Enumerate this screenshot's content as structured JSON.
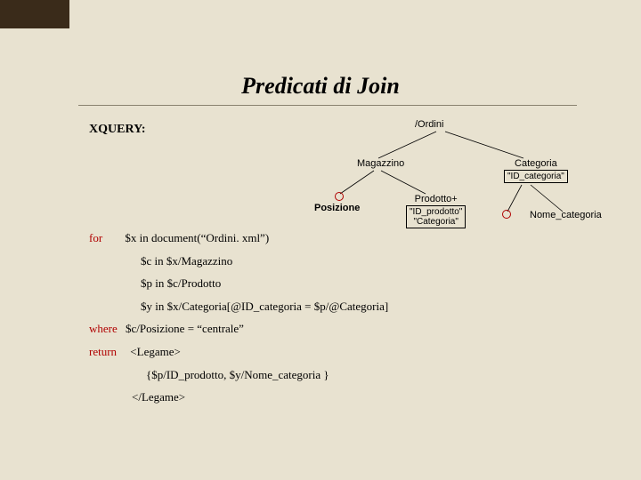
{
  "title": "Predicati di Join",
  "labels": {
    "xquery": "XQUERY:"
  },
  "query": {
    "kw_for": "for",
    "for_x": "$x in document(“Ordini. xml”)",
    "for_c": "$c in $x/Magazzino",
    "for_p": "$p in $c/Prodotto",
    "for_y": "$y in $x/Categoria[@ID_categoria = $p/@Categoria]",
    "kw_where": "where",
    "where_clause": "$c/Posizione = “centrale”",
    "kw_return": "return",
    "ret_open": "<Legame>",
    "ret_body": "{$p/ID_prodotto,  $y/Nome_categoria }",
    "ret_close": "</Legame>"
  },
  "tree": {
    "root": "/Ordini",
    "magazzino": "Magazzino",
    "posizione": "Posizione",
    "prodotto": "Prodotto+",
    "prodotto_attrs": "\"ID_prodotto\"\n\"Categoria\"",
    "categoria": "Categoria",
    "categoria_attr": "\"ID_categoria\"",
    "nome_categoria": "Nome_categoria"
  }
}
